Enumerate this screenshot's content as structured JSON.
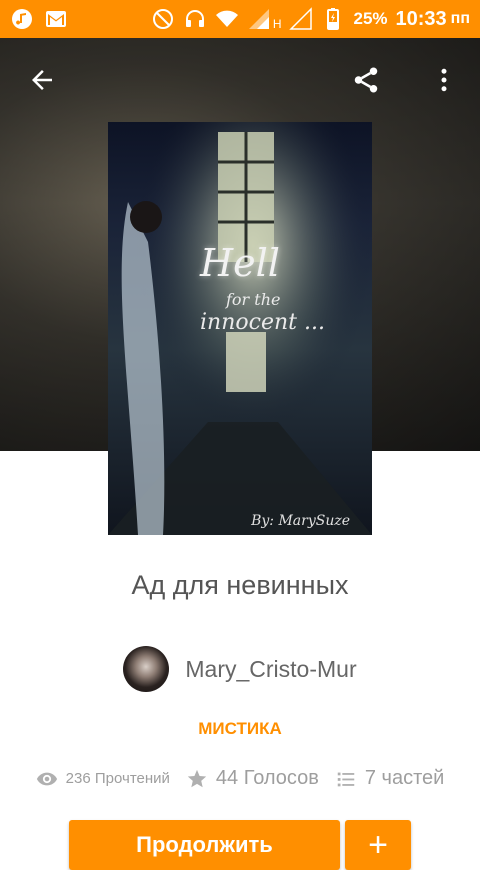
{
  "status_bar": {
    "battery_percent": "25%",
    "time": "10:33",
    "am_pm": "пп",
    "network_label": "H",
    "icons": [
      "music-icon",
      "gmail-icon",
      "do-not-disturb-icon",
      "headset-icon",
      "wifi-icon",
      "signal-icon",
      "signal-icon",
      "battery-charging-icon"
    ]
  },
  "toolbar": {
    "back_icon": "arrow-back-icon",
    "share_icon": "share-icon",
    "more_icon": "more-vert-icon"
  },
  "cover": {
    "title_line1": "Hell",
    "title_line2": "for the",
    "title_line3": "innocent ...",
    "author_sign": "By: MarySuze"
  },
  "story": {
    "title": "Ад для невинных",
    "author": "Mary_Cristo-Mur",
    "genre": "МИСТИКА"
  },
  "stats": {
    "reads": "236 Прочтений",
    "votes": "44 Голосов",
    "parts": "7 частей"
  },
  "actions": {
    "continue_label": "Продолжить",
    "add_label": "+"
  },
  "colors": {
    "accent": "#ff8f00",
    "text_muted": "#9e9e9e"
  }
}
